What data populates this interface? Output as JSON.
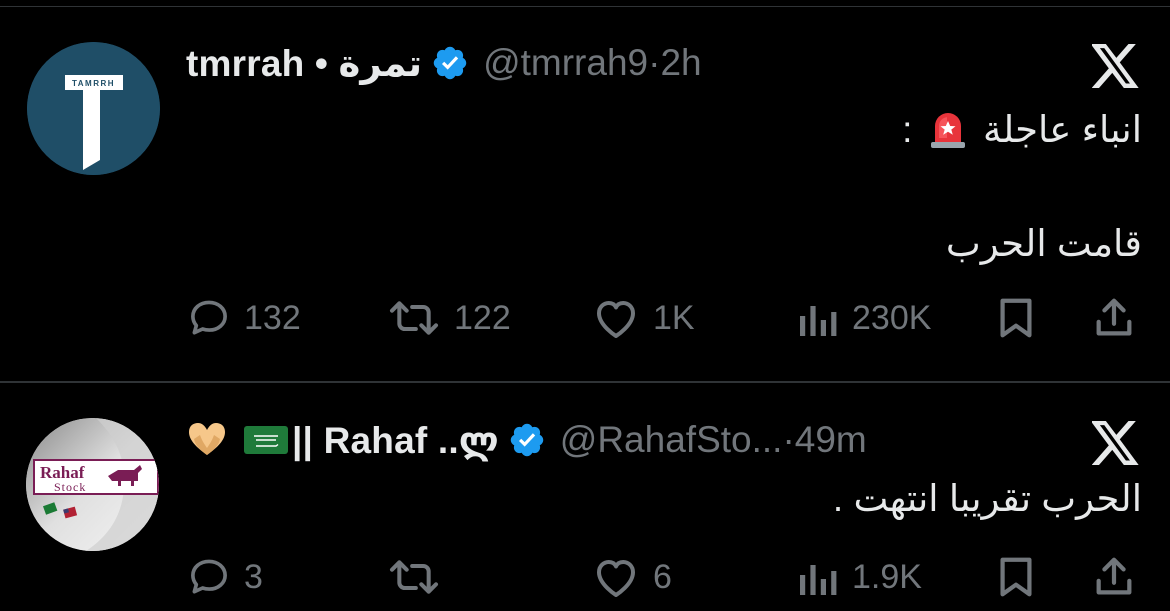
{
  "tweets": [
    {
      "display_name": "tmrrah • تمرة",
      "handle": "@tmrrah9",
      "time_sep": " · ",
      "time": "2h",
      "avatar_logo_text": "TAMRRH",
      "body_line1": "انباء عاجلة",
      "body_line1_suffix": " :",
      "body_line2": "قامت الحرب",
      "stats": {
        "replies": "132",
        "reposts": "122",
        "likes": "1K",
        "views": "230K"
      }
    },
    {
      "display_name": "|| Rahaf ..ლ",
      "handle": "@RahafSto...",
      "time_sep": " · ",
      "time": "49m",
      "avatar_logo_text": "Rahaf",
      "avatar_logo_subtext": "Stock",
      "body_line1": "الحرب تقريبا انتهت .",
      "stats": {
        "replies": "3",
        "reposts": "",
        "likes": "6",
        "views": "1.9K"
      }
    }
  ],
  "colors": {
    "background": "#000000",
    "text": "#e7e9ea",
    "muted": "#71767b",
    "verified": "#1d9bf0",
    "divider": "#2f3336"
  },
  "icons": [
    "x-logo-icon",
    "verified-badge-icon",
    "reply-icon",
    "repost-icon",
    "like-icon",
    "views-icon",
    "bookmark-icon",
    "share-icon",
    "siren-emoji",
    "heart-hands-emoji",
    "saudi-flag-emoji"
  ]
}
